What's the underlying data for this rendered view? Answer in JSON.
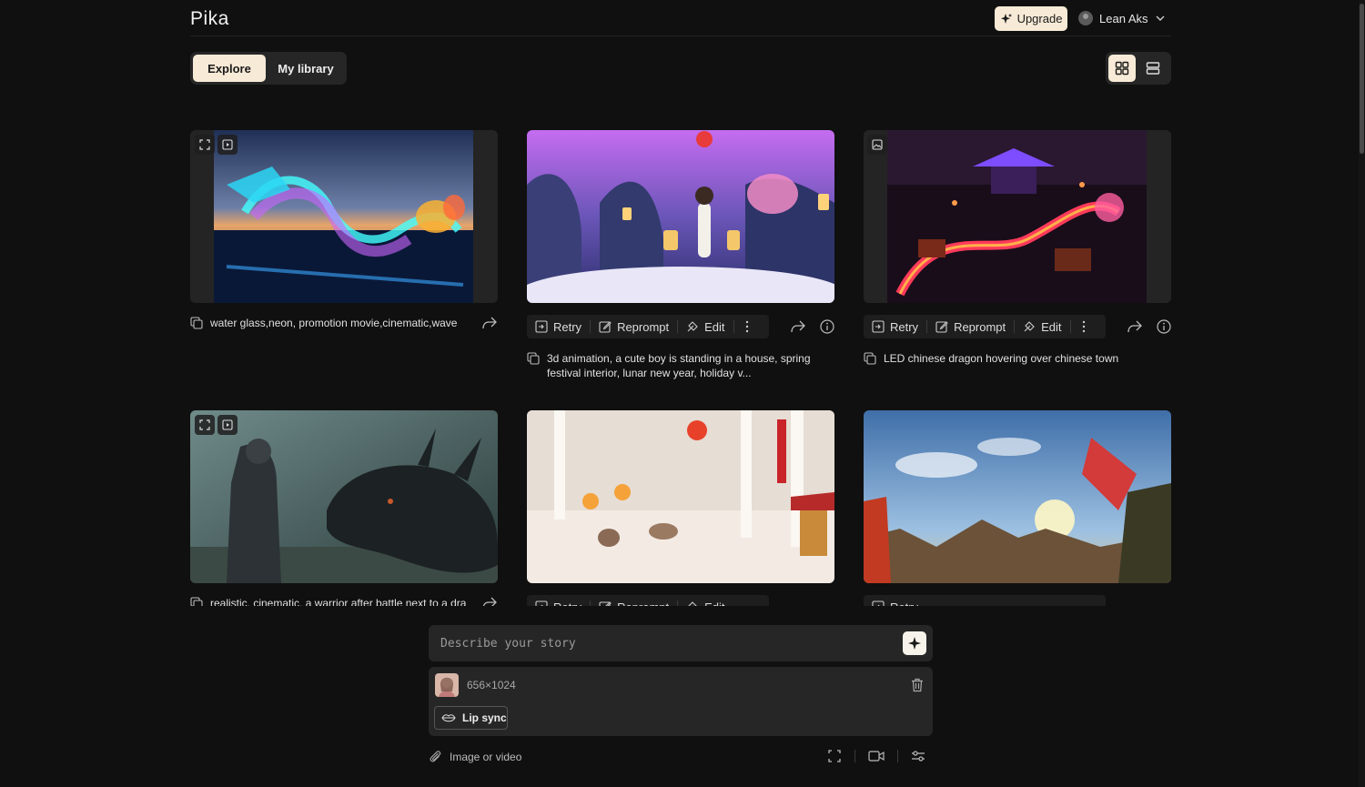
{
  "app": {
    "name": "Pika"
  },
  "header": {
    "upgrade_label": "Upgrade",
    "user_name": "Lean Aks"
  },
  "tabs": [
    {
      "label": "Explore",
      "active": true
    },
    {
      "label": "My library",
      "active": false
    }
  ],
  "view_toggle": {
    "active": "grid"
  },
  "cards": [
    {
      "prompt": "water glass,neon, promotion movie,cinematic,wave",
      "media": "video",
      "has_actions": false
    },
    {
      "prompt": "3d animation, a cute boy is standing in a house, spring festival interior, lunar new year, holiday v...",
      "has_actions": true
    },
    {
      "prompt": "LED chinese dragon hovering over chinese town",
      "media": "image",
      "has_actions": true
    },
    {
      "prompt": "realistic, cinematic, a warrior after battle next to a dra",
      "media": "video",
      "has_actions": false
    },
    {
      "prompt": "",
      "has_actions": true
    },
    {
      "prompt": "",
      "has_actions": true
    }
  ],
  "actions": {
    "retry": "Retry",
    "reprompt": "Reprompt",
    "edit": "Edit"
  },
  "composer": {
    "placeholder": "Describe your story",
    "attachment_dims": "656×1024",
    "lipsync_label": "Lip sync",
    "attach_label": "Image or video"
  },
  "colors": {
    "accent": "#f7ead6",
    "background": "#101010",
    "panel": "#262626"
  }
}
